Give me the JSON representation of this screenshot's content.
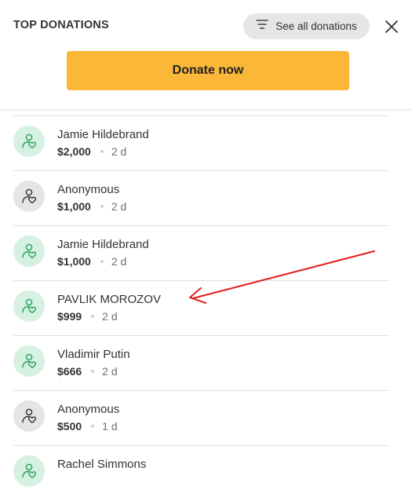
{
  "header": {
    "title": "TOP DONATIONS",
    "see_all_label": "See all donations",
    "donate_label": "Donate now"
  },
  "donations": [
    {
      "name": "Jamie Hildebrand",
      "amount": "$2,000",
      "time": "2 d",
      "avatar": "green"
    },
    {
      "name": "Anonymous",
      "amount": "$1,000",
      "time": "2 d",
      "avatar": "gray"
    },
    {
      "name": "Jamie Hildebrand",
      "amount": "$1,000",
      "time": "2 d",
      "avatar": "green"
    },
    {
      "name": "PAVLIK MOROZOV",
      "amount": "$999",
      "time": "2 d",
      "avatar": "green"
    },
    {
      "name": "Vladimir Putin",
      "amount": "$666",
      "time": "2 d",
      "avatar": "green"
    },
    {
      "name": "Anonymous",
      "amount": "$500",
      "time": "1 d",
      "avatar": "gray"
    },
    {
      "name": "Rachel Simmons",
      "amount": "",
      "time": "",
      "avatar": "green"
    }
  ],
  "colors": {
    "accent_button": "#fbb737",
    "avatar_green_bg": "#d6f0e1",
    "avatar_green_icon": "#2aa060",
    "avatar_gray_bg": "#e5e5e5",
    "avatar_gray_icon": "#333333",
    "annotation_arrow": "#e02020"
  },
  "icons": {
    "avatar": "donor-heart-icon",
    "filter": "filter-lines-icon",
    "close": "close-icon"
  }
}
